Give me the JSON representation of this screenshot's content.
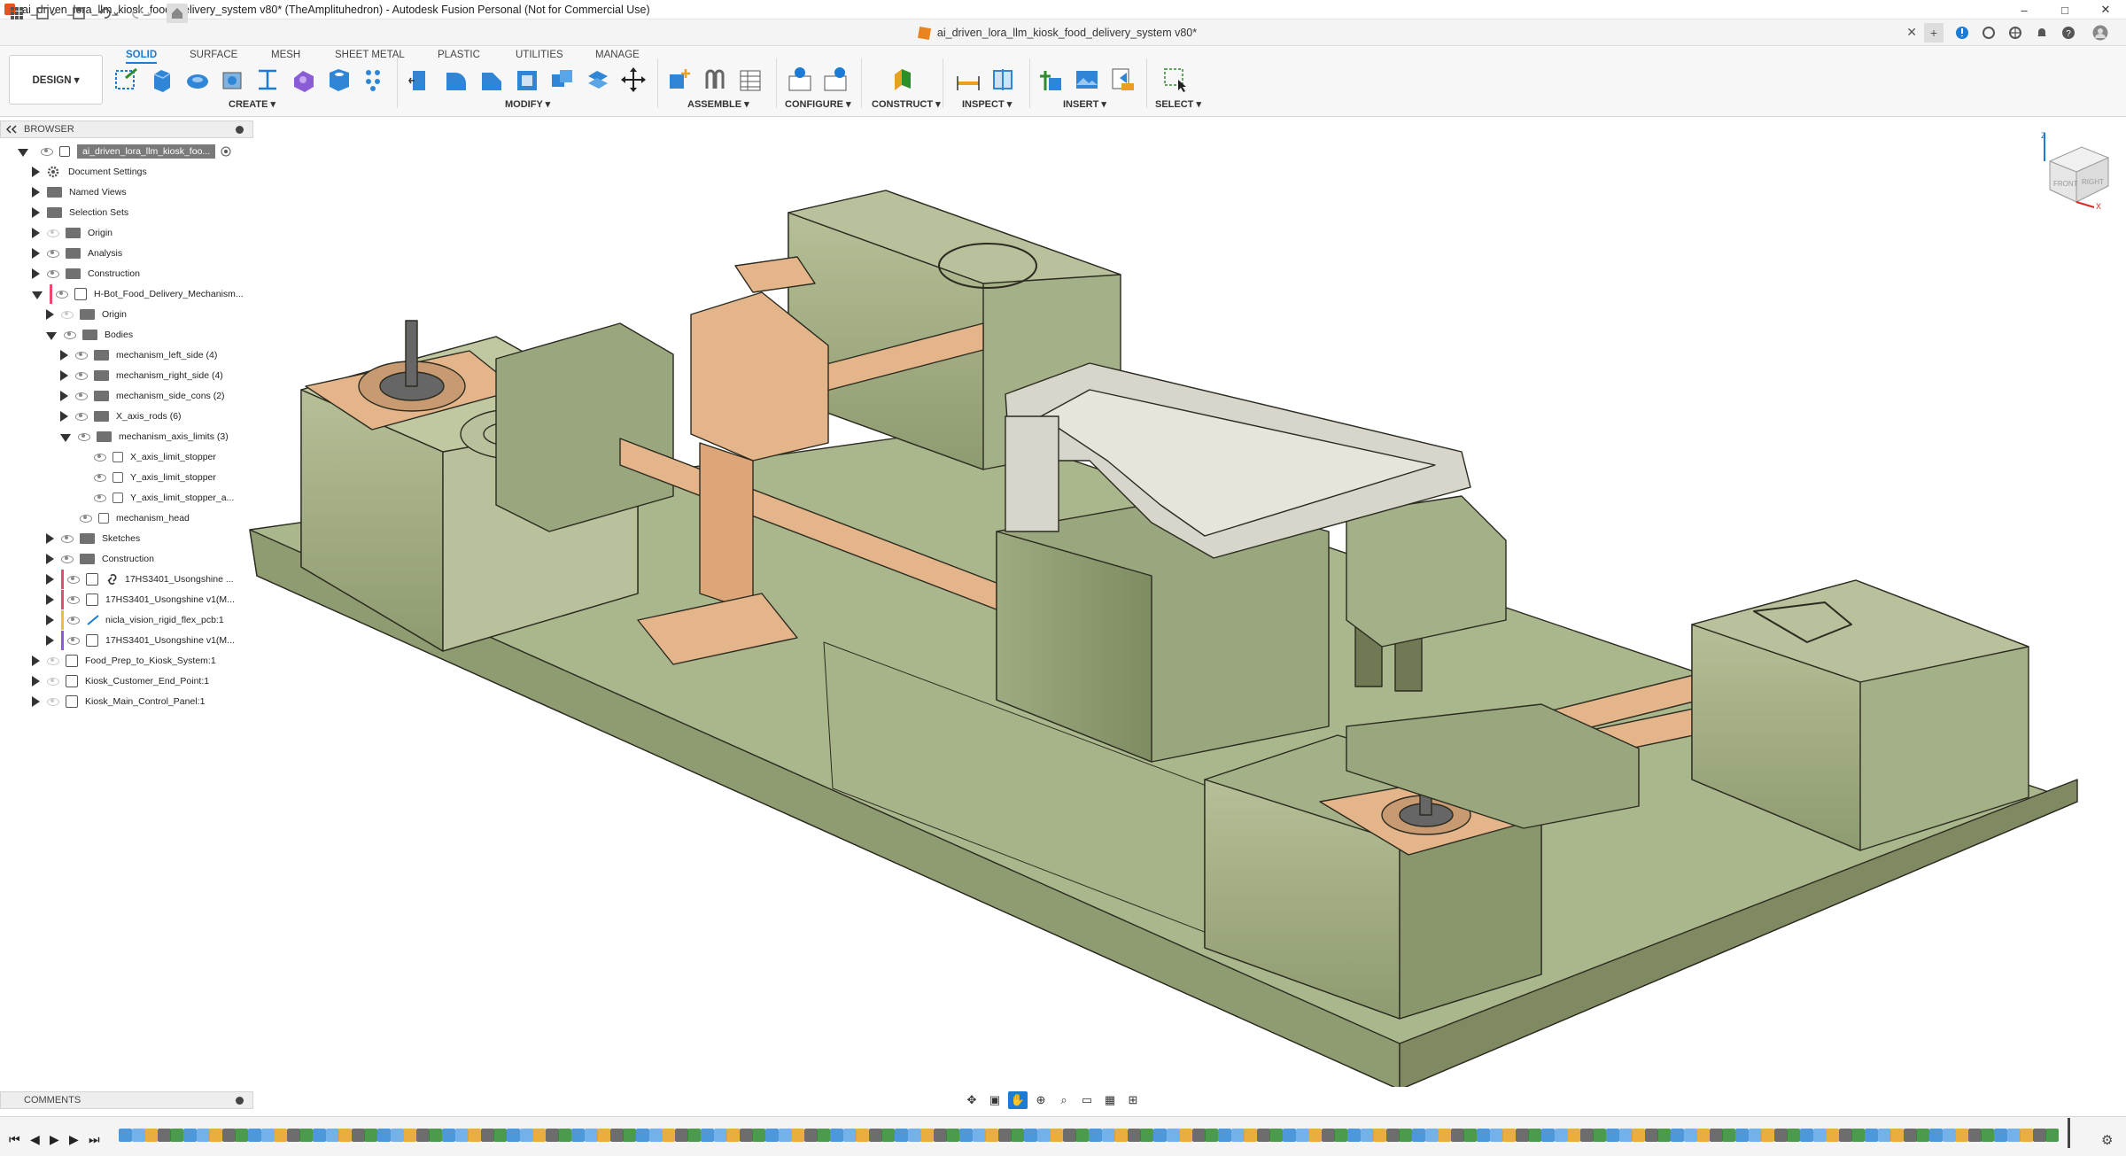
{
  "window": {
    "title": "ai_driven_lora_llm_kiosk_food_delivery_system v80* (TheAmplituhedron) - Autodesk Fusion Personal (Not for Commercial Use)",
    "minimize": "–",
    "maximize": "□",
    "close": "✕"
  },
  "doc_tab": {
    "title": "ai_driven_lora_llm_kiosk_food_delivery_system v80*",
    "close": "✕"
  },
  "workspace": {
    "label": "DESIGN ▾"
  },
  "tabs": [
    "SOLID",
    "SURFACE",
    "MESH",
    "SHEET METAL",
    "PLASTIC",
    "UTILITIES",
    "MANAGE"
  ],
  "groups": [
    "CREATE ▾",
    "MODIFY ▾",
    "ASSEMBLE ▾",
    "CONFIGURE ▾",
    "CONSTRUCT ▾",
    "INSPECT ▾",
    "INSERT ▾",
    "SELECT ▾"
  ],
  "browser": {
    "header": "BROWSER",
    "root": "ai_driven_lora_llm_kiosk_foo...",
    "items": [
      "Document Settings",
      "Named Views",
      "Selection Sets",
      "Origin",
      "Analysis",
      "Construction",
      "H-Bot_Food_Delivery_Mechanism...",
      "Origin",
      "Bodies",
      "mechanism_left_side (4)",
      "mechanism_right_side (4)",
      "mechanism_side_cons (2)",
      "X_axis_rods (6)",
      "mechanism_axis_limits (3)",
      "X_axis_limit_stopper",
      "Y_axis_limit_stopper",
      "Y_axis_limit_stopper_a...",
      "mechanism_head",
      "Sketches",
      "Construction",
      "17HS3401_Usongshine ...",
      "17HS3401_Usongshine v1(M...",
      "nicla_vision_rigid_flex_pcb:1",
      "17HS3401_Usongshine v1(M...",
      "Food_Prep_to_Kiosk_System:1",
      "Kiosk_Customer_End_Point:1",
      "Kiosk_Main_Control_Panel:1"
    ]
  },
  "comments": {
    "header": "COMMENTS"
  },
  "viewcube": {
    "front": "FRONT",
    "right": "RIGHT",
    "z": "Z",
    "x": "X"
  },
  "colors": {
    "accent": "#1a7cd6",
    "model_green": "#9aa77e",
    "model_orange": "#e4b48a",
    "tray": "#d8d5ca"
  }
}
